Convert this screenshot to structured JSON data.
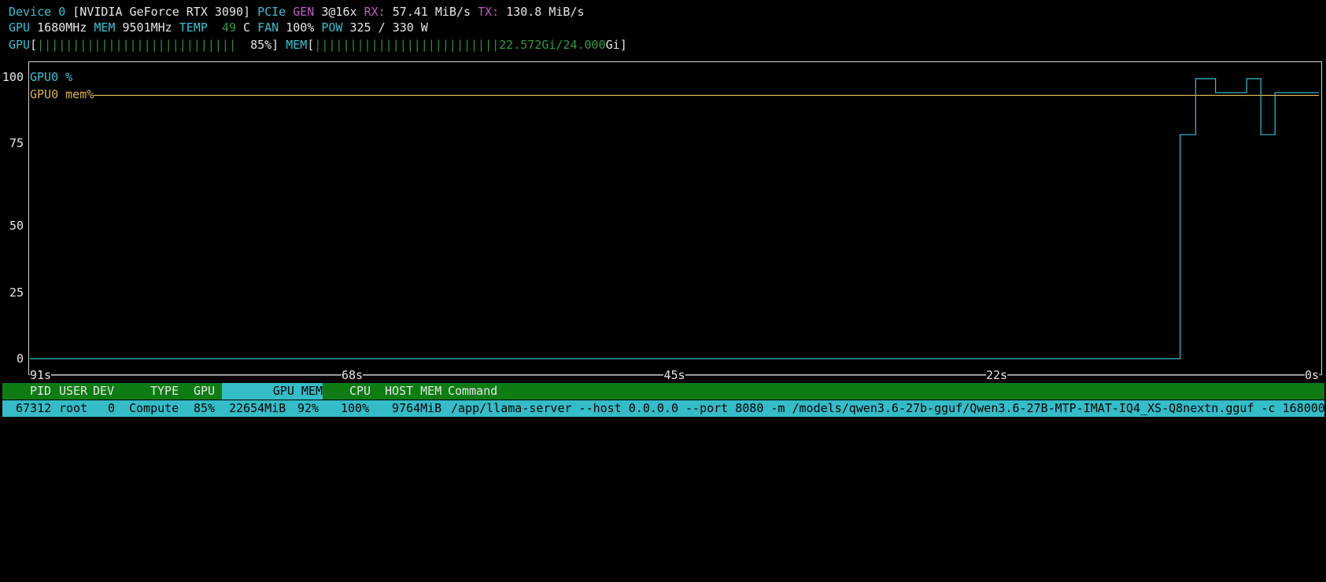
{
  "header": {
    "line1": {
      "device_label": "Device 0",
      "device_name": "[NVIDIA GeForce RTX 3090]",
      "pcie_label": "PCIe",
      "gen_label": "GEN",
      "gen_value": "3@16x",
      "rx_label": "RX:",
      "rx_value": "57.41 MiB/s",
      "tx_label": "TX:",
      "tx_value": "130.8 MiB/s"
    },
    "line2": {
      "gpu_label": "GPU",
      "gpu_clock": "1680MHz",
      "mem_label": "MEM",
      "mem_clock": "9501MHz",
      "temp_label": "TEMP",
      "temp_value": "49",
      "temp_unit": "C",
      "fan_label": "FAN",
      "fan_value": "100%",
      "pow_label": "POW",
      "pow_value": "325 / 330 W"
    },
    "line3": {
      "gpu_label": "GPU",
      "gpu_bar_open": "[",
      "gpu_bar_fill": "||||||||||||||||||||||||||||",
      "gpu_bar_pct": "85%",
      "gpu_bar_close": "]",
      "gpu_util_fraction": 0.85,
      "mem_label": "MEM",
      "mem_bar_open": "[",
      "mem_bar_fill": "||||||||||||||||||||||||||",
      "mem_used": "22.572Gi/24.000",
      "mem_unit": "Gi",
      "mem_bar_close": "]"
    }
  },
  "chart_data": {
    "type": "line",
    "y_ticks": [
      "100",
      "75",
      "50",
      "25",
      "0"
    ],
    "ylim": [
      0,
      100
    ],
    "x_ticks": [
      "91s",
      "68s",
      "45s",
      "22s",
      "0s"
    ],
    "xlim": [
      -91,
      0
    ],
    "series": [
      {
        "name": "GPU0 %",
        "color": "#37c2d3",
        "points": [
          [
            -91,
            0
          ],
          [
            -9.8,
            0
          ],
          [
            -9.8,
            80
          ],
          [
            -8.7,
            80
          ],
          [
            -8.7,
            100
          ],
          [
            -7.3,
            100
          ],
          [
            -7.3,
            95
          ],
          [
            -5.1,
            95
          ],
          [
            -5.1,
            100
          ],
          [
            -4.1,
            100
          ],
          [
            -4.1,
            80
          ],
          [
            -3.1,
            80
          ],
          [
            -3.1,
            95
          ],
          [
            0,
            95
          ]
        ]
      },
      {
        "name": "GPU0 mem%",
        "color": "#d8b24b",
        "points": [
          [
            -91,
            94
          ],
          [
            0,
            94
          ]
        ]
      }
    ]
  },
  "process_table": {
    "headers": {
      "pid": "PID",
      "user": "USER",
      "dev": "DEV",
      "type": "TYPE",
      "gpu": "GPU",
      "gpu_mem": "GPU MEM",
      "cpu": "CPU",
      "host_mem": "HOST MEM",
      "command": "Command"
    },
    "rows": [
      {
        "pid": "67312",
        "user": "root",
        "dev": "0",
        "type": "Compute",
        "gpu": "85%",
        "gpu_mem": "22654MiB",
        "gpu_mem_pct": "92%",
        "cpu": "100%",
        "host_mem": "9764MiB",
        "command": "/app/llama-server --host 0.0.0.0 --port 8080 -m /models/qwen3.6-27b-gguf/Qwen3.6-27B-MTP-IMAT-IQ4_XS-Q8nextn.gguf -c 168000"
      }
    ]
  },
  "colors": {
    "accent_cyan": "#37c2d3",
    "accent_magenta": "#c15ac4",
    "bar_green": "#2a8f3a",
    "table_header_bg": "#0e7c12",
    "selected_row_bg": "#34bcc7",
    "mem_series": "#d8b24b"
  }
}
